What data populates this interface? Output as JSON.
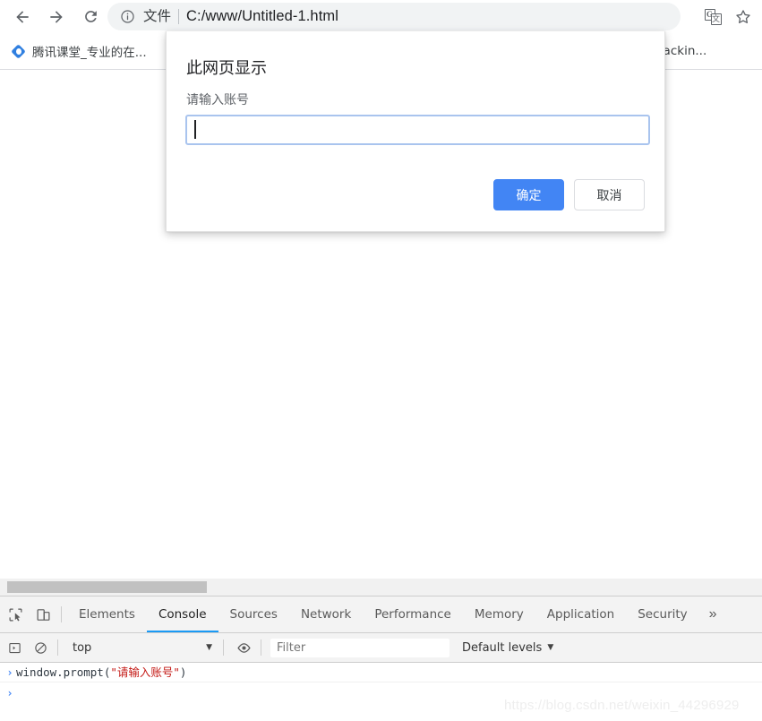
{
  "browser": {
    "nav": {
      "back_label": "Back",
      "forward_label": "Forward",
      "reload_label": "Reload"
    },
    "omnibox": {
      "info_icon": "info-circle-icon",
      "scheme_label": "文件",
      "url": "C:/www/Untitled-1.html"
    },
    "actions": [
      {
        "name": "translate-icon",
        "glyph_back": "G",
        "glyph_front": "文"
      },
      {
        "name": "bookmark-star-icon",
        "label": "☆"
      }
    ]
  },
  "bookmarks": {
    "items": [
      {
        "label": "腾讯课堂_专业的在...",
        "favicon": "tencent-classroom-favicon"
      },
      {
        "label": "hackin...",
        "favicon": "none"
      }
    ]
  },
  "dialog": {
    "title": "此网页显示",
    "message": "请输入账号",
    "input_value": "",
    "input_placeholder": "",
    "confirm_label": "确定",
    "cancel_label": "取消",
    "confirm_color": "#4285f4"
  },
  "devtools": {
    "tools": [
      {
        "name": "inspect-element-icon"
      },
      {
        "name": "device-toolbar-icon"
      }
    ],
    "tabs": [
      {
        "label": "Elements",
        "active": false
      },
      {
        "label": "Console",
        "active": true
      },
      {
        "label": "Sources",
        "active": false
      },
      {
        "label": "Network",
        "active": false
      },
      {
        "label": "Performance",
        "active": false
      },
      {
        "label": "Memory",
        "active": false
      },
      {
        "label": "Application",
        "active": false
      },
      {
        "label": "Security",
        "active": false
      }
    ],
    "more_tabs_label": "»",
    "console_toolbar": {
      "sidebar_toggle_icon": "console-sidebar-icon",
      "clear_console_icon": "clear-console-icon",
      "context_value": "top",
      "context_arrow": "▼",
      "live_expression_icon": "eye-icon",
      "filter_placeholder": "Filter",
      "filter_value": "",
      "levels_label": "Default levels",
      "levels_arrow": "▼"
    },
    "console_entries": [
      {
        "prompt": "›",
        "code_prefix": "window.prompt(",
        "code_string": "\"请输入账号\"",
        "code_suffix": ")"
      }
    ],
    "console_prompt": "›"
  },
  "watermark": "https://blog.csdn.net/weixin_44296929"
}
